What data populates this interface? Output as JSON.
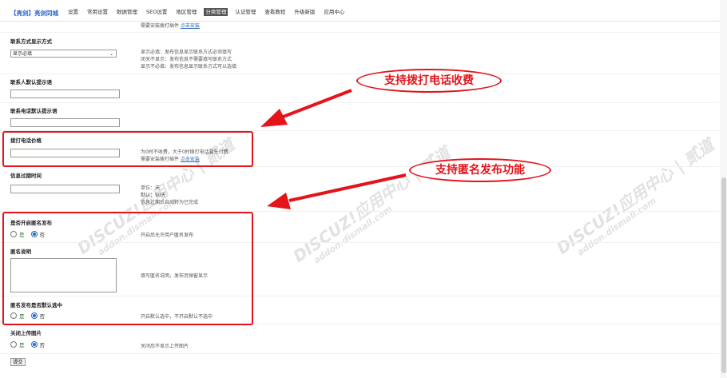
{
  "header": {
    "brand": "【亮剑】亮剑同城",
    "nav": [
      "设置",
      "常用设置",
      "数据管理",
      "SEO设置",
      "地区管理",
      "分类管理",
      "认证管理",
      "查看教程",
      "升级新版",
      "应用中心"
    ],
    "active_index": 5
  },
  "top_hint": {
    "text": "需要安装拨打插件 ",
    "link": "点击安装"
  },
  "contact_mode": {
    "title": "联系方式显示方式",
    "selected": "显示必填",
    "hints": [
      "显示必填：发布信息显示联系方式必须填写",
      "闭关不显示：发布信息不需要填写联系方式",
      "显示不必填：发布信息显示联系方式可以选填"
    ]
  },
  "contact_name": {
    "title": "联系人默认提示语",
    "value": ""
  },
  "contact_phone": {
    "title": "联系电话默认提示语",
    "value": ""
  },
  "call_price": {
    "title": "拨打电话价格",
    "value": "",
    "hint": "为0时不收费，大于0时拨打电话要先付费",
    "hint2": "需要安装拨打插件 ",
    "link": "点击安装"
  },
  "expire": {
    "title": "信息过期时间",
    "value": "",
    "hints": [
      "单位：天",
      "默认：90天",
      "信息过期后自动转为已完成"
    ]
  },
  "anon_enable": {
    "title": "是否开启匿名发布",
    "yes": "是",
    "no": "否",
    "selected": "no",
    "hint": "开启后允许用户匿名发布"
  },
  "anon_desc": {
    "title": "匿名说明",
    "hint": "填写匿名说明，发布页弹窗显示"
  },
  "anon_default": {
    "title": "匿名发布是否默认选中",
    "yes": "是",
    "no": "否",
    "selected": "no",
    "hint": "开启默认选中，不开启默认不选中"
  },
  "close_upload": {
    "title": "关闭上传图片",
    "yes": "是",
    "no": "否",
    "selected": "no",
    "hint": "关闭后不显示上传图片"
  },
  "submit_label": "提交",
  "annotations": {
    "call_fee": "支持拨打电话收费",
    "anonymous": "支持匿名发布功能"
  },
  "watermark": {
    "main": "DISCUZ!应用中心 | 贰道",
    "sub": "addon.dismall.com"
  },
  "colors": {
    "accent": "#2b66c4",
    "annotation_red": "#e4141b"
  }
}
